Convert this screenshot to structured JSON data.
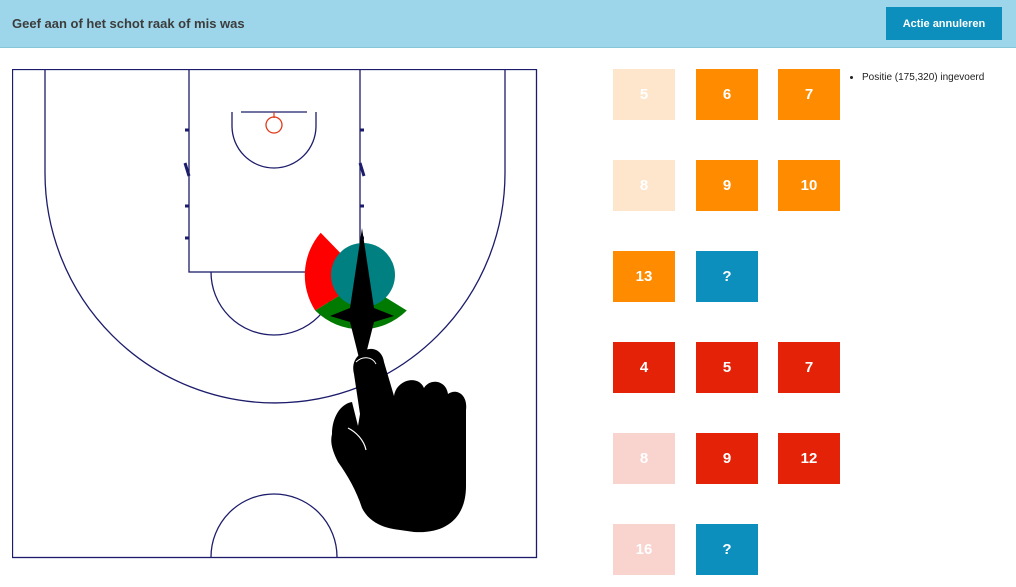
{
  "header": {
    "title": "Geef aan of het schot raak of mis was",
    "cancel_label": "Actie annuleren"
  },
  "colors": {
    "header_bg": "#9dd6ea",
    "cancel_button": "#0c8fbd",
    "court_line": "#1c1c6b",
    "rim": "#e03a1a",
    "made_orange": "#ff8c00",
    "made_orange_faded": "#fde6cc",
    "missed_red": "#e32208",
    "missed_red_faded": "#f9d3cd",
    "unknown_blue": "#0c8fbd",
    "selector_red": "#ff0000",
    "selector_green": "#007a00",
    "selector_teal": "#008080"
  },
  "player_tiles": {
    "made_section": [
      {
        "label": "5",
        "style": "made-faded"
      },
      {
        "label": "6",
        "style": "made"
      },
      {
        "label": "7",
        "style": "made"
      },
      {
        "label": "8",
        "style": "made-faded"
      },
      {
        "label": "9",
        "style": "made"
      },
      {
        "label": "10",
        "style": "made"
      },
      {
        "label": "13",
        "style": "made"
      },
      {
        "label": "?",
        "style": "unknown"
      }
    ],
    "missed_section": [
      {
        "label": "4",
        "style": "missed"
      },
      {
        "label": "5",
        "style": "missed"
      },
      {
        "label": "7",
        "style": "missed"
      },
      {
        "label": "8",
        "style": "missed-faded"
      },
      {
        "label": "9",
        "style": "missed"
      },
      {
        "label": "12",
        "style": "missed"
      },
      {
        "label": "16",
        "style": "missed-faded"
      },
      {
        "label": "?",
        "style": "unknown"
      }
    ]
  },
  "log": {
    "entries": [
      "Positie (175,320) ingevoerd"
    ]
  },
  "icons": {
    "hand": "hand-pointer-icon",
    "selector": "shot-result-selector"
  }
}
